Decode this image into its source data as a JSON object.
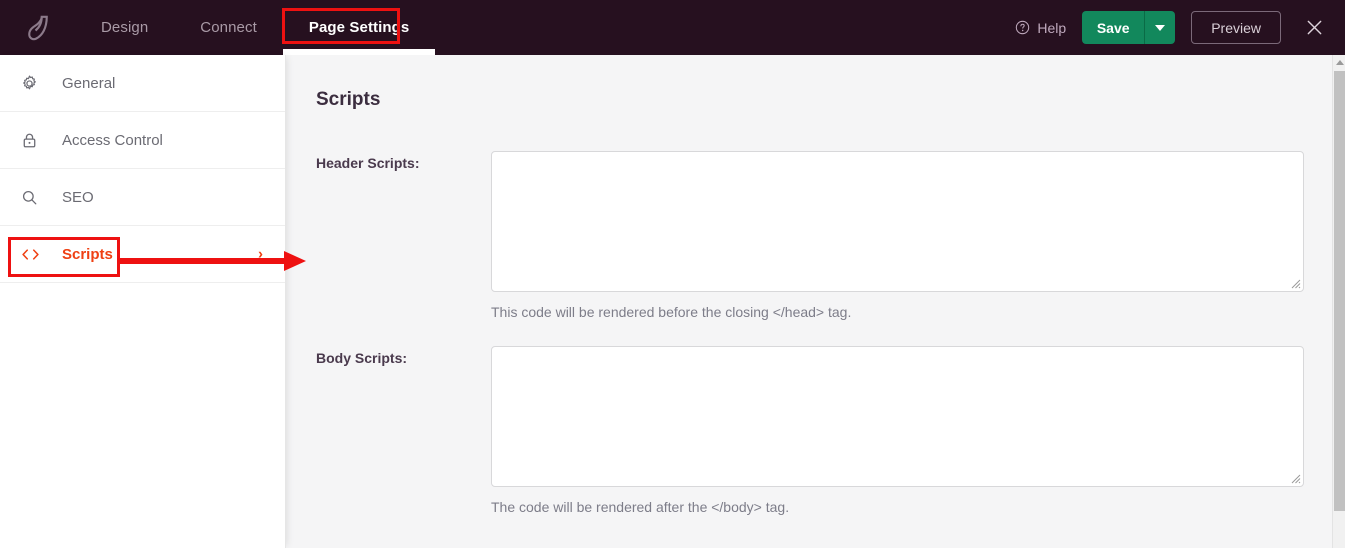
{
  "topbar": {
    "logo_icon": "leaf-logo-icon",
    "tabs": [
      {
        "label": "Design",
        "active": false
      },
      {
        "label": "Connect",
        "active": false
      },
      {
        "label": "Page Settings",
        "active": true
      }
    ],
    "help_label": "Help",
    "help_icon": "question-circle-icon",
    "save_label": "Save",
    "save_caret_icon": "chevron-down-icon",
    "preview_label": "Preview",
    "close_icon": "close-icon",
    "colors": {
      "bar_background": "#26101f",
      "save_green": "#12885c",
      "tab_inactive_text": "#a99aa6",
      "tab_active_text": "#ffffff"
    }
  },
  "sidebar": {
    "items": [
      {
        "label": "General",
        "icon": "gear-icon",
        "active": false
      },
      {
        "label": "Access Control",
        "icon": "lock-icon",
        "active": false
      },
      {
        "label": "SEO",
        "icon": "search-icon",
        "active": false
      },
      {
        "label": "Scripts",
        "icon": "code-icon",
        "active": true,
        "chevron": "›"
      }
    ],
    "active_color": "#ef4013"
  },
  "main": {
    "title": "Scripts",
    "fields": [
      {
        "label": "Header Scripts:",
        "value": "",
        "placeholder": "",
        "hint": "This code will be rendered before the closing </head> tag."
      },
      {
        "label": "Body Scripts:",
        "value": "",
        "placeholder": "",
        "hint": "The code will be rendered after the </body> tag."
      }
    ]
  },
  "scrollbar": {
    "up_arrow_icon": "scroll-up-arrow-icon",
    "thumb_position": "top"
  },
  "annotations": {
    "color": "#ee1111",
    "highlight_tab": "Page Settings",
    "highlight_sidebar_item": "Scripts",
    "arrow_icon": "right-arrow-annotation-icon"
  }
}
